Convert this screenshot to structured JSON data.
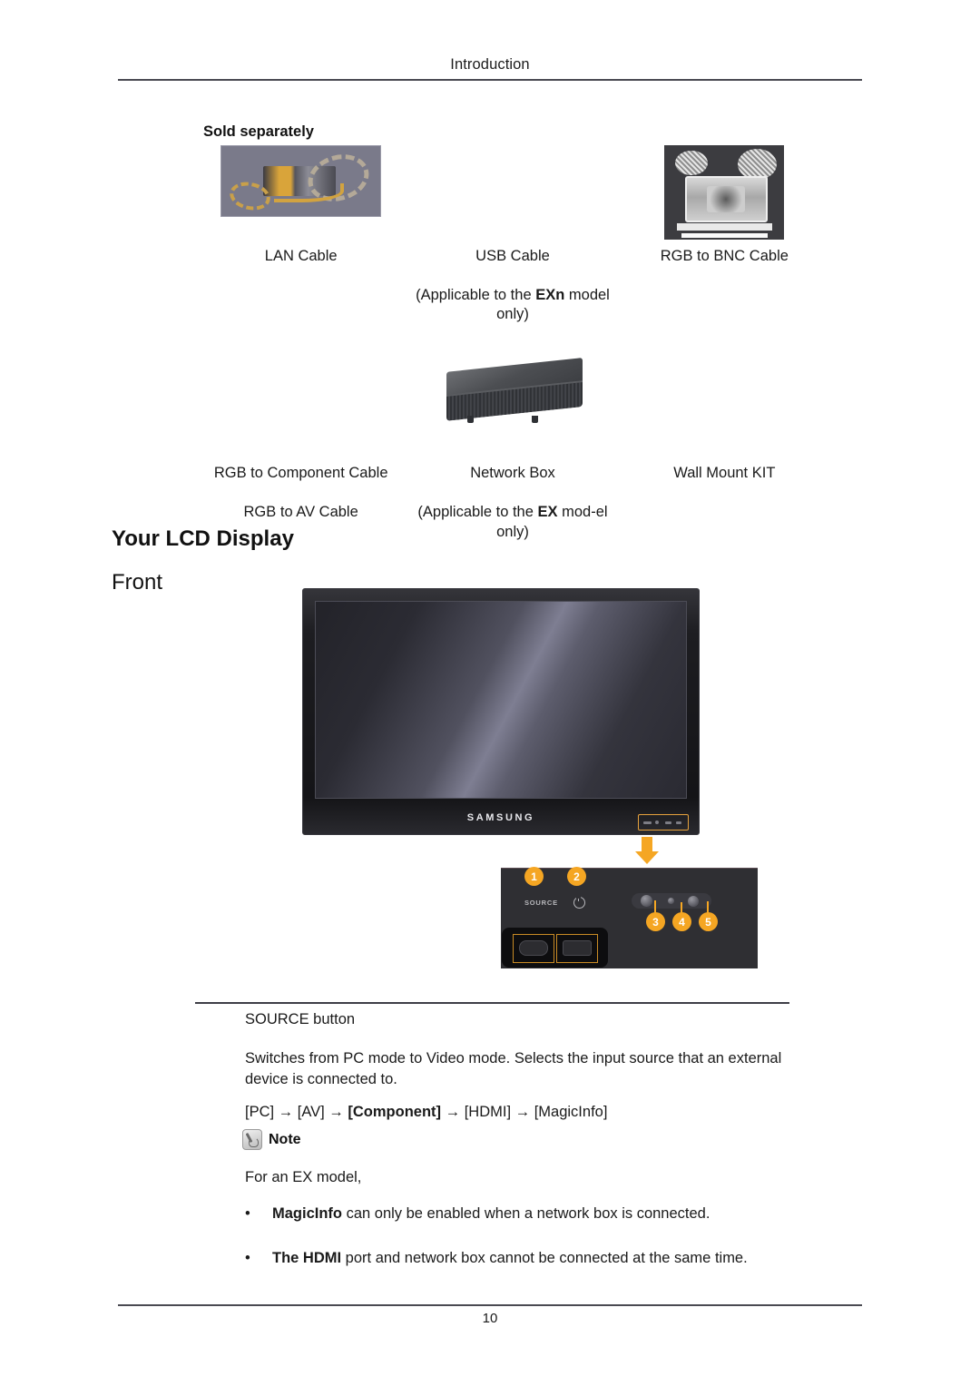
{
  "header": {
    "title": "Introduction"
  },
  "sold_separately": {
    "heading": "Sold separately",
    "items": [
      {
        "label": "LAN Cable",
        "note": "",
        "image": "lan-cable-image"
      },
      {
        "label": "USB Cable",
        "note": "(Applicable to the EXn model only)",
        "note_pre": "(Applicable to the ",
        "note_bold": "EXn",
        "note_post": " model only)",
        "image": ""
      },
      {
        "label": "RGB to BNC Cable",
        "note": "",
        "image": "rgb-to-bnc-cable-image"
      },
      {
        "label": "RGB to Component Cable",
        "note": "RGB to AV Cable",
        "image": ""
      },
      {
        "label": "Network Box",
        "note": "(Applicable to the EX model only)",
        "note_pre": "(Applicable to the ",
        "note_bold": "EX",
        "note_post": " mod-el only)",
        "image": "network-box-image"
      },
      {
        "label": "Wall Mount KIT",
        "note": "",
        "image": ""
      }
    ]
  },
  "sections": {
    "your_lcd_display": "Your LCD Display",
    "front": "Front"
  },
  "monitor": {
    "brand": "SAMSUNG",
    "callouts": [
      "1",
      "2",
      "3",
      "4",
      "5"
    ],
    "panel_source_label": "SOURCE",
    "panel_power_icon": "power-icon",
    "accent_color": "#f5a623"
  },
  "body": {
    "source_button_title": "SOURCE button",
    "source_description": "Switches from PC mode to Video mode. Selects the input source that an external device is connected to.",
    "source_sequence_parts": [
      {
        "text": "[PC] → [AV] → ",
        "bold": false
      },
      {
        "text": "[Component]",
        "bold": true
      },
      {
        "text": " → [HDMI] → [MagicInfo]",
        "bold": false
      }
    ],
    "source_sequence_plain": "[PC] → [AV] → [Component] → [HDMI] → [MagicInfo]",
    "note_label": "Note",
    "note_intro": "For an EX model,",
    "bullet_marker": "•",
    "bullets": [
      {
        "bold_lead": "MagicInfo",
        "rest": " can only be enabled when a network box is connected."
      },
      {
        "bold_lead": "The HDMI",
        "rest": " port and network box cannot be connected at the same time."
      }
    ]
  },
  "footer": {
    "page_number": "10"
  }
}
